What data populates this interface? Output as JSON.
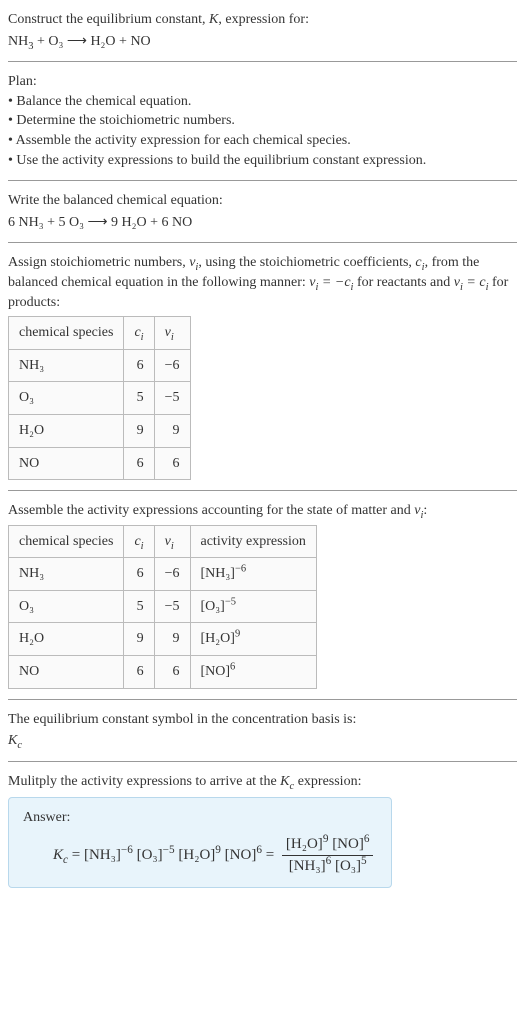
{
  "intro": {
    "line1_a": "Construct the equilibrium constant, ",
    "line1_b": ", expression for:",
    "eq_lhs": "NH",
    "eq_rhs_full": " + O₃  ⟶  H₂O + NO"
  },
  "plan": {
    "title": "Plan:",
    "b1": "• Balance the chemical equation.",
    "b2": "• Determine the stoichiometric numbers.",
    "b3": "• Assemble the activity expression for each chemical species.",
    "b4": "• Use the activity expressions to build the equilibrium constant expression."
  },
  "balanced": {
    "label": "Write the balanced chemical equation:",
    "eq": "6 NH₃ + 5 O₃  ⟶  9 H₂O + 6 NO"
  },
  "assign": {
    "p1a": "Assign stoichiometric numbers, ",
    "p1b": ", using the stoichiometric coefficients, ",
    "p1c": ", from the balanced chemical equation in the following manner: ",
    "p1d": " for reactants and ",
    "p1e": " for products:"
  },
  "table1": {
    "h1": "chemical species",
    "rows": [
      {
        "sp": "NH₃",
        "c": "6",
        "v": "−6"
      },
      {
        "sp": "O₃",
        "c": "5",
        "v": "−5"
      },
      {
        "sp": "H₂O",
        "c": "9",
        "v": "9"
      },
      {
        "sp": "NO",
        "c": "6",
        "v": "6"
      }
    ]
  },
  "assemble": {
    "p_a": "Assemble the activity expressions accounting for the state of matter and ",
    "p_b": ":"
  },
  "table2": {
    "h1": "chemical species",
    "h4": "activity expression",
    "rows": [
      {
        "sp": "NH₃",
        "c": "6",
        "v": "−6",
        "ae_base": "[NH₃]",
        "ae_exp": "−6"
      },
      {
        "sp": "O₃",
        "c": "5",
        "v": "−5",
        "ae_base": "[O₃]",
        "ae_exp": "−5"
      },
      {
        "sp": "H₂O",
        "c": "9",
        "v": "9",
        "ae_base": "[H₂O]",
        "ae_exp": "9"
      },
      {
        "sp": "NO",
        "c": "6",
        "v": "6",
        "ae_base": "[NO]",
        "ae_exp": "6"
      }
    ]
  },
  "kc_symbol": {
    "label": "The equilibrium constant symbol in the concentration basis is:"
  },
  "multiply": {
    "p_a": "Mulitply the activity expressions to arrive at the ",
    "p_b": " expression:"
  },
  "answer": {
    "label": "Answer:",
    "eq_mid": " = ",
    "eq_sep": " "
  },
  "sym": {
    "K": "K",
    "Kc_K": "K",
    "Kc_c": "c",
    "nu": "ν",
    "i": "i",
    "c": "c",
    "eq": " = ",
    "neg": "−",
    "nh3": "[NH₃]",
    "o3": "[O₃]",
    "h2o": "[H₂O]",
    "no": "[NO]",
    "e_n6": "−6",
    "e_n5": "−5",
    "e_9": "9",
    "e_6": "6",
    "e_6b": "6",
    "e_5": "5"
  }
}
